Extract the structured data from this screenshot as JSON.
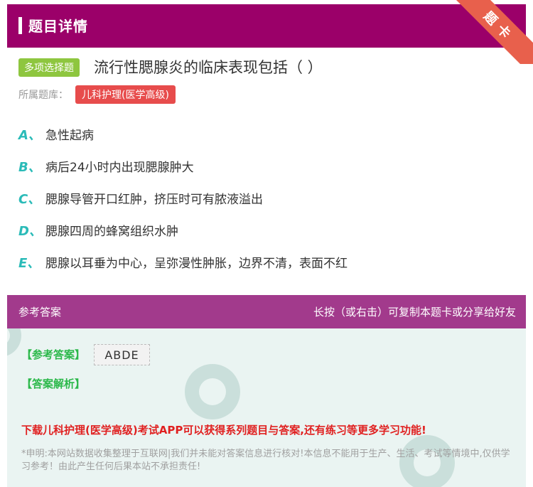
{
  "header": {
    "title": "题目详情",
    "ribbon": "题卡"
  },
  "question": {
    "type_tag": "多项选择题",
    "text": "流行性腮腺炎的临床表现包括（ ）",
    "bank_label": "所属题库：",
    "bank_name": "儿科护理(医学高级)"
  },
  "options": [
    {
      "letter": "A、",
      "text": "急性起病"
    },
    {
      "letter": "B、",
      "text": "病后24小时内出现腮腺肿大"
    },
    {
      "letter": "C、",
      "text": "腮腺导管开口红肿，挤压时可有脓液溢出"
    },
    {
      "letter": "D、",
      "text": "腮腺四周的蜂窝组织水肿"
    },
    {
      "letter": "E、",
      "text": "腮腺以耳垂为中心，呈弥漫性肿胀，边界不清，表面不红"
    }
  ],
  "answer_section": {
    "title": "参考答案",
    "hint": "长按（或右击）可复制本题卡或分享给好友",
    "answer_label": "【参考答案】",
    "answer_value": "ABDE",
    "analysis_label": "【答案解析】",
    "promo": "下载儿科护理(医学高级)考试APP可以获得系列题目与答案,还有练习等更多学习功能!",
    "disclaimer": "*申明:本网站数据收集整理于互联网|我们并未能对答案信息进行核对!本信息不能用于生产、生活、考试等情境中,仅供学习参考！由此产生任何后果本站不承担责任!"
  },
  "colors": {
    "header_bg": "#9b0069",
    "answer_bar": "#a23a8c",
    "option_letter": "#2bbbb8",
    "answer_green": "#2bb84a",
    "promo_red": "#e02020"
  }
}
